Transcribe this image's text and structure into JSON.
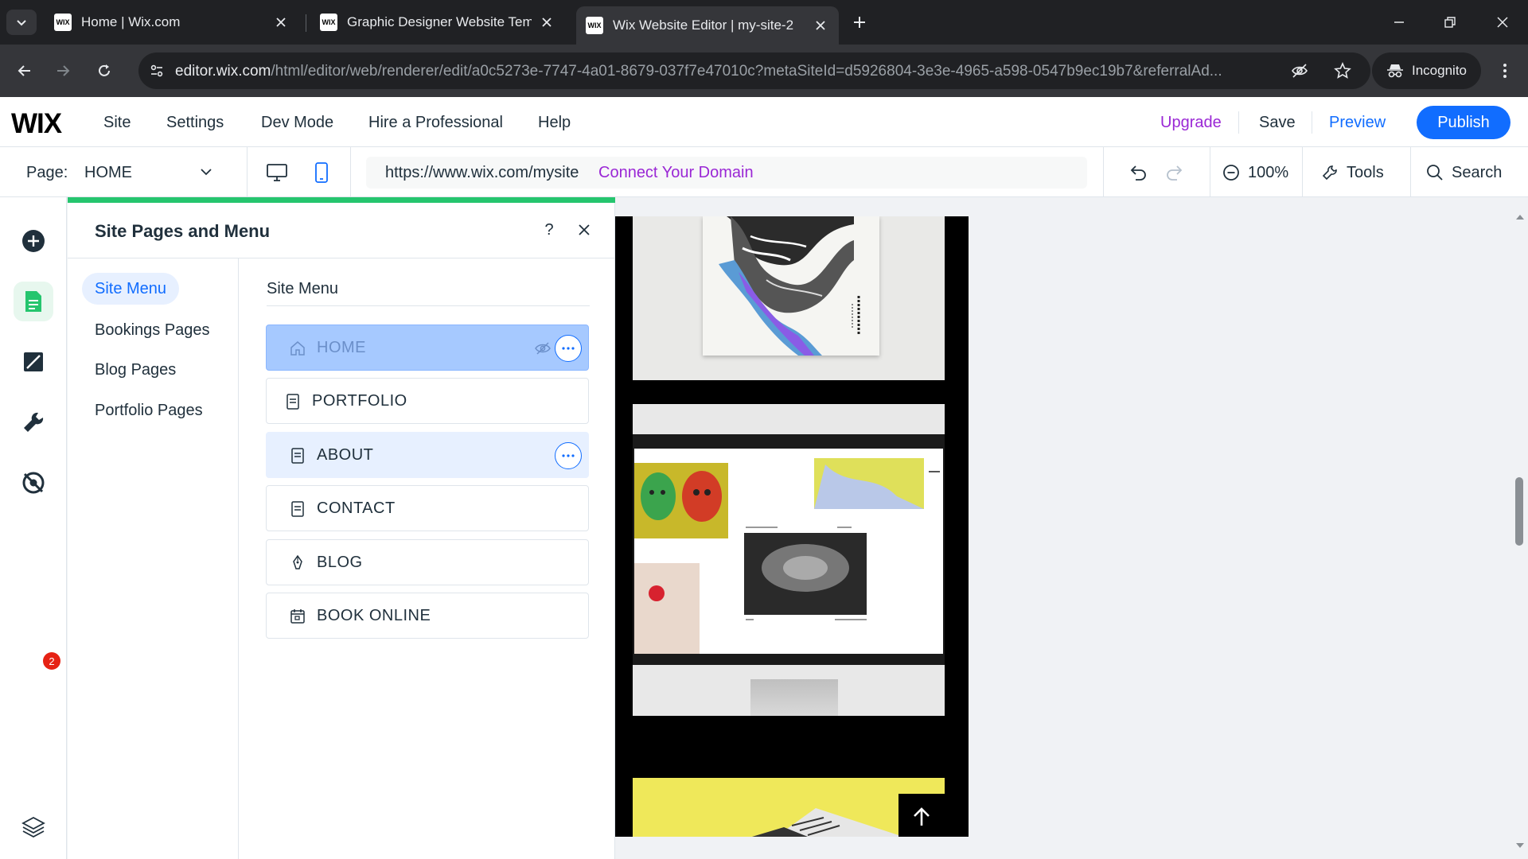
{
  "browser": {
    "tabs": [
      {
        "title": "Home | Wix.com",
        "favicon": "WIX",
        "active": false
      },
      {
        "title": "Graphic Designer Website Temp",
        "favicon": "WIX",
        "active": false
      },
      {
        "title": "Wix Website Editor | my-site-2",
        "favicon": "WIX",
        "active": true
      }
    ],
    "url_host": "editor.wix.com",
    "url_rest": "/html/editor/web/renderer/edit/a0c5273e-7747-4a01-8679-037f7e47010c?metaSiteId=d5926804-3e3e-4965-a598-0547b9ec19b7&referralAd...",
    "incognito_label": "Incognito"
  },
  "wix_topbar": {
    "logo": "WIX",
    "menu": [
      "Site",
      "Settings",
      "Dev Mode",
      "Hire a Professional",
      "Help"
    ],
    "upgrade": "Upgrade",
    "save": "Save",
    "preview": "Preview",
    "publish": "Publish",
    "colors": {
      "publish": "#116dff",
      "upgrade": "#9a27d5"
    }
  },
  "toolbar": {
    "page_label": "Page:",
    "page_value": "HOME",
    "site_url": "https://www.wix.com/mysite",
    "connect_domain": "Connect Your Domain",
    "zoom": "100%",
    "tools": "Tools",
    "search": "Search"
  },
  "rail": {
    "icons": [
      "add-icon",
      "pages-icon",
      "design-icon",
      "wrench-icon",
      "no-eye-icon",
      "layers-icon"
    ],
    "badge": "2"
  },
  "panel": {
    "title": "Site Pages and Menu",
    "help": "?",
    "side_nav": [
      "Site Menu",
      "Bookings Pages",
      "Blog Pages",
      "Portfolio Pages"
    ],
    "menu_heading": "Site Menu",
    "pages": [
      {
        "label": "HOME",
        "icon": "home-icon",
        "state": "selected",
        "hidden_icon": true
      },
      {
        "label": "PORTFOLIO",
        "icon": "page-icon",
        "state": "normal"
      },
      {
        "label": "ABOUT",
        "icon": "page-icon",
        "state": "hover"
      },
      {
        "label": "CONTACT",
        "icon": "page-icon",
        "state": "normal"
      },
      {
        "label": "BLOG",
        "icon": "pen-icon",
        "state": "normal"
      },
      {
        "label": "BOOK ONLINE",
        "icon": "calendar-icon",
        "state": "normal"
      }
    ]
  }
}
